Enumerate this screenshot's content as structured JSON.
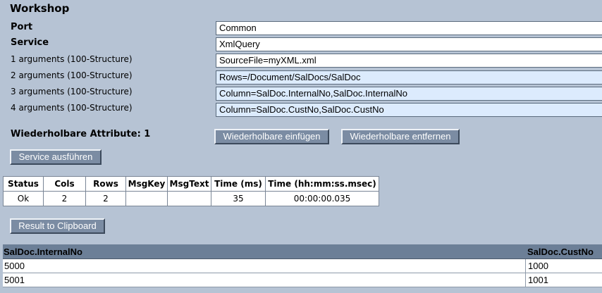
{
  "header": {
    "title": "Workshop"
  },
  "form": {
    "port_label": "Port",
    "port_value": "Common",
    "service_label": "Service",
    "service_value": "XmlQuery",
    "args": [
      {
        "label": "1 arguments (100-Structure)",
        "value": "SourceFile=myXML.xml"
      },
      {
        "label": "2 arguments (100-Structure)",
        "value": "Rows=/Document/SalDocs/SalDoc"
      },
      {
        "label": "3 arguments (100-Structure)",
        "value": "Column=SalDoc.InternalNo,SalDoc.InternalNo"
      },
      {
        "label": "4 arguments (100-Structure)",
        "value": "Column=SalDoc.CustNo,SalDoc.CustNo"
      }
    ],
    "repeatable_label": "Wiederholbare Attribute: 1",
    "insert_button": "Wiederholbare einfügen",
    "remove_button": "Wiederholbare entfernen",
    "run_button": "Service ausführen"
  },
  "status_table": {
    "headers": [
      "Status",
      "Cols",
      "Rows",
      "MsgKey",
      "MsgText",
      "Time (ms)",
      "Time (hh:mm:ss.msec)"
    ],
    "row": [
      "Ok",
      "2",
      "2",
      "",
      "",
      "35",
      "00:00:00.035"
    ]
  },
  "clipboard_button": "Result to Clipboard",
  "result_table": {
    "headers": [
      "SalDoc.InternalNo",
      "SalDoc.CustNo"
    ],
    "rows": [
      [
        "5000",
        "1000"
      ],
      [
        "5001",
        "1001"
      ]
    ]
  }
}
